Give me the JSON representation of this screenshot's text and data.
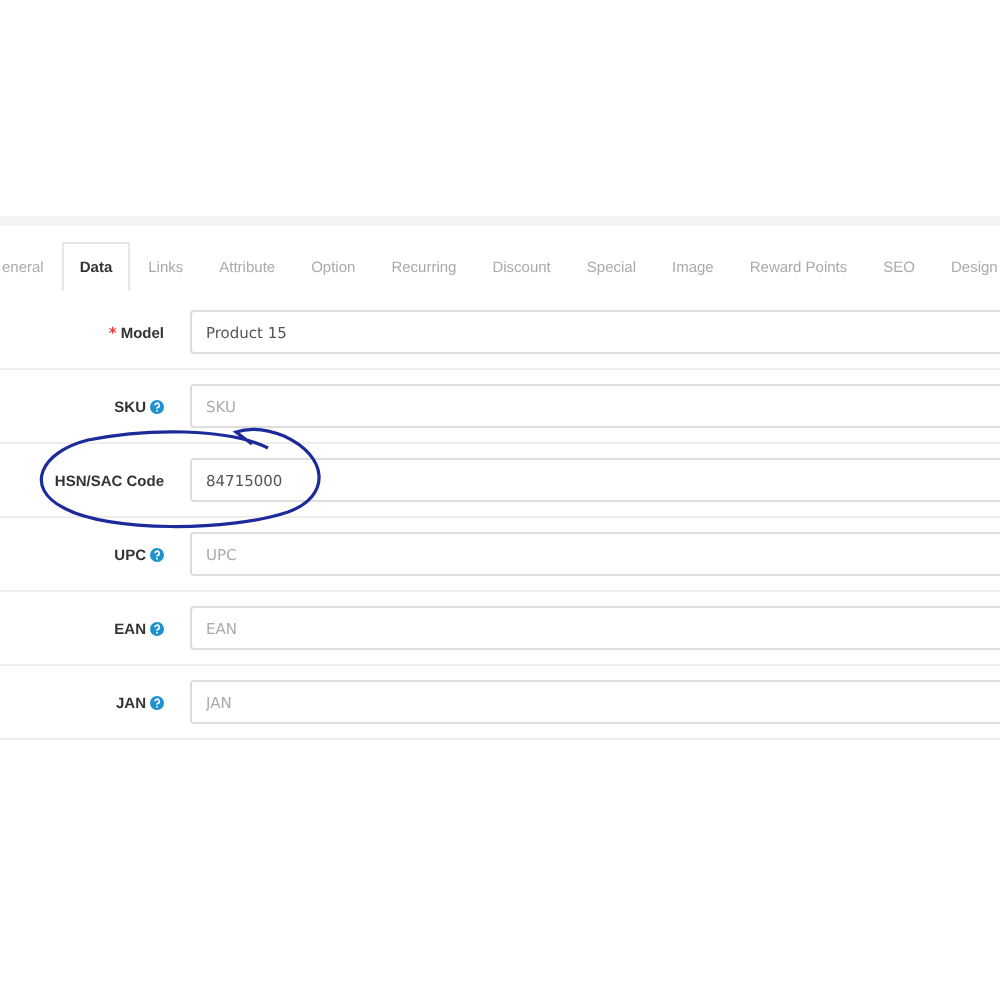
{
  "tabs": [
    {
      "label": "eneral",
      "selected": false
    },
    {
      "label": "Data",
      "selected": true
    },
    {
      "label": "Links",
      "selected": false
    },
    {
      "label": "Attribute",
      "selected": false
    },
    {
      "label": "Option",
      "selected": false
    },
    {
      "label": "Recurring",
      "selected": false
    },
    {
      "label": "Discount",
      "selected": false
    },
    {
      "label": "Special",
      "selected": false
    },
    {
      "label": "Image",
      "selected": false
    },
    {
      "label": "Reward Points",
      "selected": false
    },
    {
      "label": "SEO",
      "selected": false
    },
    {
      "label": "Design",
      "selected": false
    }
  ],
  "fields": [
    {
      "label": "Model",
      "required_mark": "*",
      "help": false,
      "value": "Product 15"
    },
    {
      "label": "SKU",
      "help": true,
      "placeholder": "SKU"
    },
    {
      "label": "HSN/SAC Code",
      "help": false,
      "value": "84715000",
      "circled": true
    },
    {
      "label": "UPC",
      "help": true,
      "placeholder": "UPC"
    },
    {
      "label": "EAN",
      "help": true,
      "placeholder": "EAN"
    },
    {
      "label": "JAN",
      "help": true,
      "placeholder": "JAN"
    }
  ]
}
